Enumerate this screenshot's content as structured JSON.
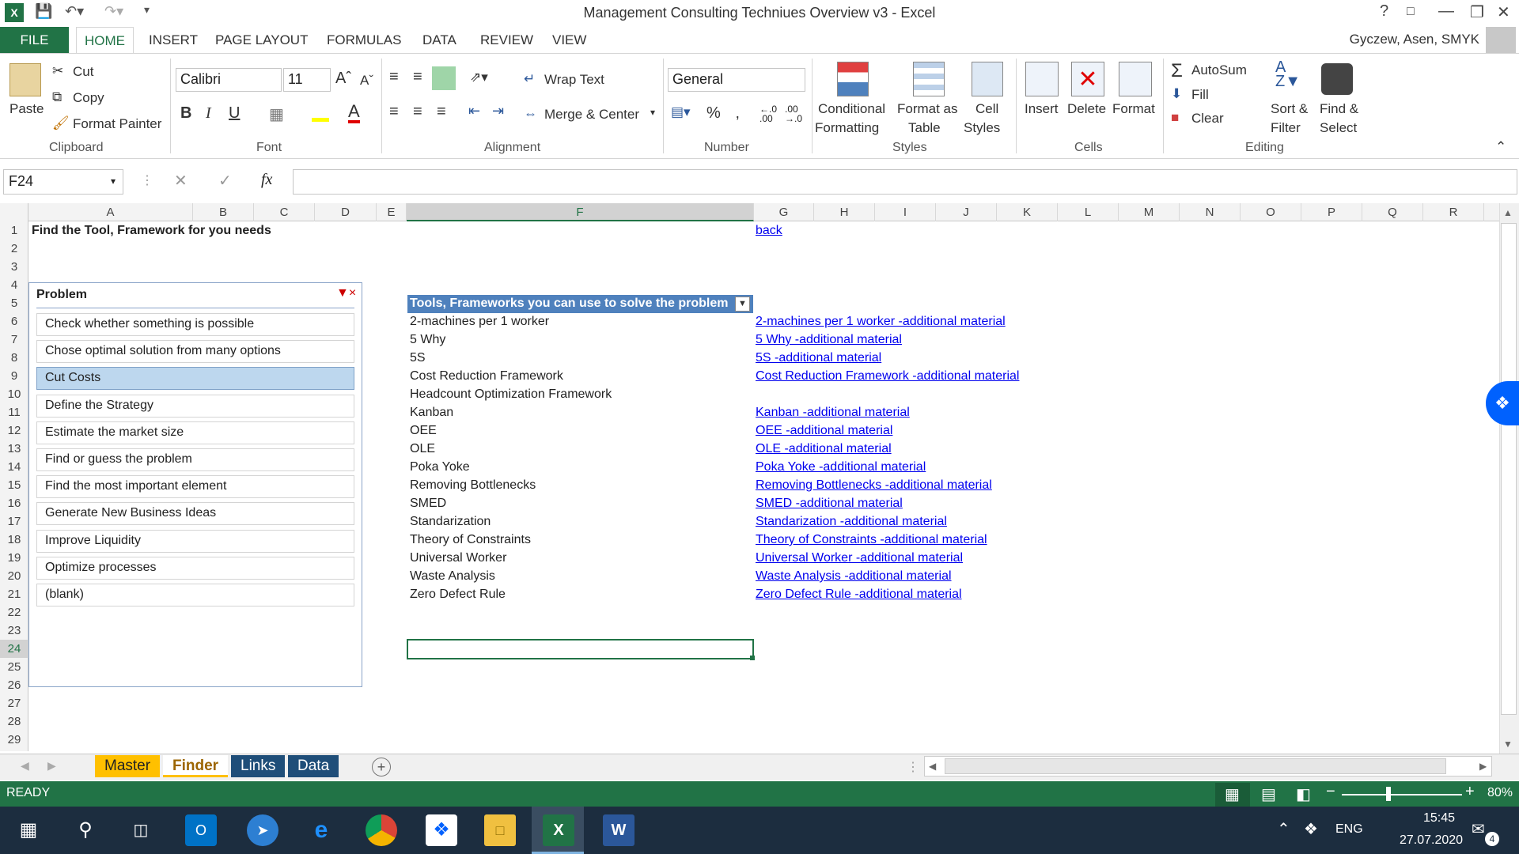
{
  "window": {
    "title": "Management Consulting Techniues Overview v3 - Excel"
  },
  "ribbon_tabs": [
    "FILE",
    "HOME",
    "INSERT",
    "PAGE LAYOUT",
    "FORMULAS",
    "DATA",
    "REVIEW",
    "VIEW"
  ],
  "user": "Gyczew, Asen, SMYK",
  "clipboard": {
    "paste": "Paste",
    "cut": "Cut",
    "copy": "Copy",
    "format_painter": "Format Painter",
    "label": "Clipboard"
  },
  "font": {
    "name": "Calibri",
    "size": "11",
    "label": "Font"
  },
  "alignment": {
    "wrap": "Wrap Text",
    "merge": "Merge & Center",
    "label": "Alignment"
  },
  "number": {
    "format": "General",
    "label": "Number",
    "percent": "%"
  },
  "styles": {
    "cond1": "Conditional",
    "cond2": "Formatting",
    "fat1": "Format as",
    "fat2": "Table",
    "cs1": "Cell",
    "cs2": "Styles",
    "label": "Styles"
  },
  "cells": {
    "insert": "Insert",
    "delete": "Delete",
    "format": "Format",
    "label": "Cells"
  },
  "editing": {
    "autosum": "AutoSum",
    "fill": "Fill",
    "clear": "Clear",
    "sort1": "Sort &",
    "sort2": "Filter",
    "find1": "Find &",
    "find2": "Select",
    "label": "Editing"
  },
  "formula_bar": {
    "name_box": "F24",
    "formula": ""
  },
  "columns": [
    "A",
    "B",
    "C",
    "D",
    "E",
    "F",
    "G",
    "H",
    "I",
    "J",
    "K",
    "L",
    "M",
    "N",
    "O",
    "P",
    "Q",
    "R"
  ],
  "rows": [
    "1",
    "2",
    "3",
    "4",
    "5",
    "6",
    "7",
    "8",
    "9",
    "10",
    "11",
    "12",
    "13",
    "14",
    "15",
    "16",
    "17",
    "18",
    "19",
    "20",
    "21",
    "22",
    "23",
    "24",
    "25",
    "26",
    "27",
    "28",
    "29"
  ],
  "sheet": {
    "a1": "Find the Tool, Framework for you needs",
    "g1": "back",
    "table_header": "Tools, Frameworks you can use to solve the problem",
    "tools": [
      "2-machines per 1 worker",
      "5 Why",
      "5S",
      "Cost Reduction Framework",
      "Headcount Optimization Framework",
      "Kanban",
      "OEE",
      "OLE",
      "Poka Yoke",
      "Removing Bottlenecks",
      "SMED",
      "Standarization",
      "Theory of Constraints",
      "Universal Worker",
      "Waste Analysis",
      "Zero Defect Rule"
    ],
    "links": [
      "2-machines per 1 worker -additional material",
      "5 Why -additional material",
      "5S -additional material",
      "Cost Reduction Framework -additional material",
      "",
      "Kanban -additional material",
      "OEE -additional material",
      "OLE -additional material",
      "Poka Yoke -additional material",
      "Removing Bottlenecks -additional material",
      "SMED -additional material",
      "Standarization -additional material",
      "Theory of Constraints -additional material",
      "Universal Worker -additional material",
      "Waste Analysis -additional material",
      "Zero Defect Rule -additional material"
    ]
  },
  "slicer": {
    "title": "Problem",
    "items": [
      "Check whether something is possible",
      "Chose optimal solution from many options",
      "Cut Costs",
      "Define the Strategy",
      "Estimate the market size",
      "Find or guess the problem",
      "Find the most important element",
      "Generate New Business Ideas",
      "Improve Liquidity",
      "Optimize processes",
      "(blank)"
    ],
    "selected": "Cut Costs"
  },
  "sheet_tabs": [
    "Master",
    "Finder",
    "Links",
    "Data"
  ],
  "status": {
    "ready": "READY",
    "zoom": "80%"
  },
  "taskbar": {
    "lang": "ENG",
    "time": "15:45",
    "date": "27.07.2020",
    "notifications": "4"
  },
  "colors": {
    "excel_green": "#217346",
    "table_header": "#4f81bd",
    "slicer_selected": "#bdd7ee",
    "master_tab": "#ffc000",
    "links_tab": "#1f4e79"
  }
}
